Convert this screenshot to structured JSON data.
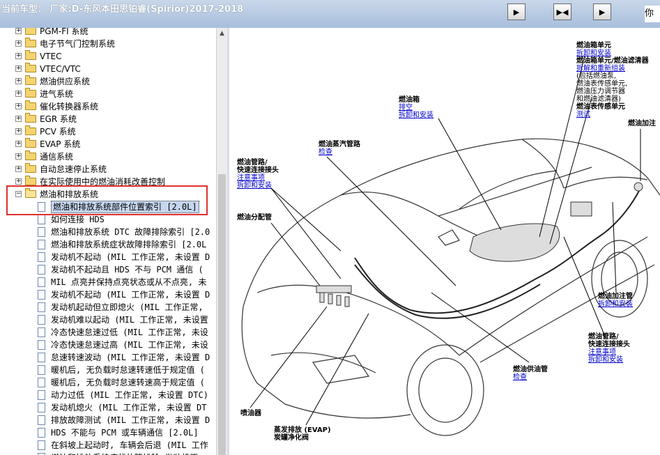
{
  "header": {
    "title": "当前车型：  厂家:D-东风本田思铂睿(Spirior)2017-2018",
    "right_text": "你"
  },
  "toolbar": {
    "btn1": "▶",
    "btn2": "▶◀",
    "btn3": "▶"
  },
  "tree": {
    "folders": [
      {
        "label": "PGM-FI 系统"
      },
      {
        "label": "电子节气门控制系统"
      },
      {
        "label": "VTEC"
      },
      {
        "label": "VTEC/VTC"
      },
      {
        "label": "燃油供应系统"
      },
      {
        "label": "进气系统"
      },
      {
        "label": "催化转换器系统"
      },
      {
        "label": "EGR 系统"
      },
      {
        "label": "PCV 系统"
      },
      {
        "label": "EVAP 系统"
      },
      {
        "label": "通信系统"
      },
      {
        "label": "自动怠速停止系统"
      },
      {
        "label": "在实际使用中的燃油消耗改善控制"
      }
    ],
    "open_folder": "燃油和排放系统",
    "items": [
      {
        "label": "燃油和排放系统部件位置索引 [2.0L]"
      },
      {
        "label": "如何连接 HDS"
      },
      {
        "label": "燃油和排放系统 DTC 故障排除索引 [2.0"
      },
      {
        "label": "燃油和排放系统症状故障排除索引 [2.0L"
      },
      {
        "label": "发动机不起动 (MIL 工作正常, 未设置 D"
      },
      {
        "label": "发动机不起动且 HDS 不与 PCM 通信 ("
      },
      {
        "label": "MIL 点亮并保持点亮状态或从不点亮, 未"
      },
      {
        "label": "发动机不起动 (MIL 工作正常, 未设置 D"
      },
      {
        "label": "发动机起动但立即熄火 (MIL 工作正常,"
      },
      {
        "label": "发动机难以起动 (MIL 工作正常, 未设置"
      },
      {
        "label": "冷态快速怠速过低 (MIL 工作正常, 未设"
      },
      {
        "label": "冷态快速怠速过高 (MIL 工作正常, 未设"
      },
      {
        "label": "怠速转速波动 (MIL 工作正常, 未设置 D"
      },
      {
        "label": "暖机后, 无负载时怠速转速低于规定值 ("
      },
      {
        "label": "暖机后, 无负载时怠速转速高于规定值 ("
      },
      {
        "label": "动力过低 (MIL 工作正常, 未设置 DTC)"
      },
      {
        "label": "发动机熄火 (MIL 工作正常, 未设置 DT"
      },
      {
        "label": "排放故障测试 (MIL 工作正常, 未设置 D"
      },
      {
        "label": "HDS 不能与 PCM 或车辆通信 [2.0L]"
      },
      {
        "label": "在斜坡上起动时, 车辆会后退 (MIL 工作"
      },
      {
        "label": "燃油和排放系统症状故障排除 发动机不"
      }
    ]
  },
  "diagram": {
    "callouts": {
      "fuel_tank_unit": {
        "title": "燃油箱单元",
        "link1": "拆卸和安装"
      },
      "fuel_tank_unit_filter": {
        "title": "燃油箱单元/燃油滤清器",
        "link1": "拆解和重新组装",
        "t1": "(包括燃油泵,",
        "t2": "燃油表传感单元,",
        "t3": "燃油压力调节器",
        "t4": "和燃油滤清器)"
      },
      "fuel_gauge_sensor": {
        "title": "燃油表传感单元",
        "link1": "测试"
      },
      "fuel_filler": {
        "title": "燃油加注"
      },
      "fuel_tank": {
        "title": "燃油箱",
        "link1": "排空",
        "link2": "拆卸和安装"
      },
      "evap_pipe": {
        "title": "燃油蒸汽管路",
        "link1": "检查"
      },
      "fuel_line_left": {
        "title1": "燃油管路/",
        "title2": "快速连接接头",
        "link1": "注意事项",
        "link2": "拆卸和安装"
      },
      "fuel_rail": {
        "title": "燃油分配管"
      },
      "filler_pipe": {
        "title": "燃油加注管",
        "link1": "拆卸和安装"
      },
      "fuel_line_right": {
        "title1": "燃油管路/",
        "title2": "快速连接接头",
        "link1": "注意事项",
        "link2": "拆卸和安装"
      },
      "fuel_feed": {
        "title": "燃油供油管",
        "link1": "检查"
      },
      "injector": {
        "title": "喷油器"
      },
      "evap_canister": {
        "title1": "蒸发排放 (EVAP)",
        "title2": "炭罐净化阀"
      }
    }
  }
}
